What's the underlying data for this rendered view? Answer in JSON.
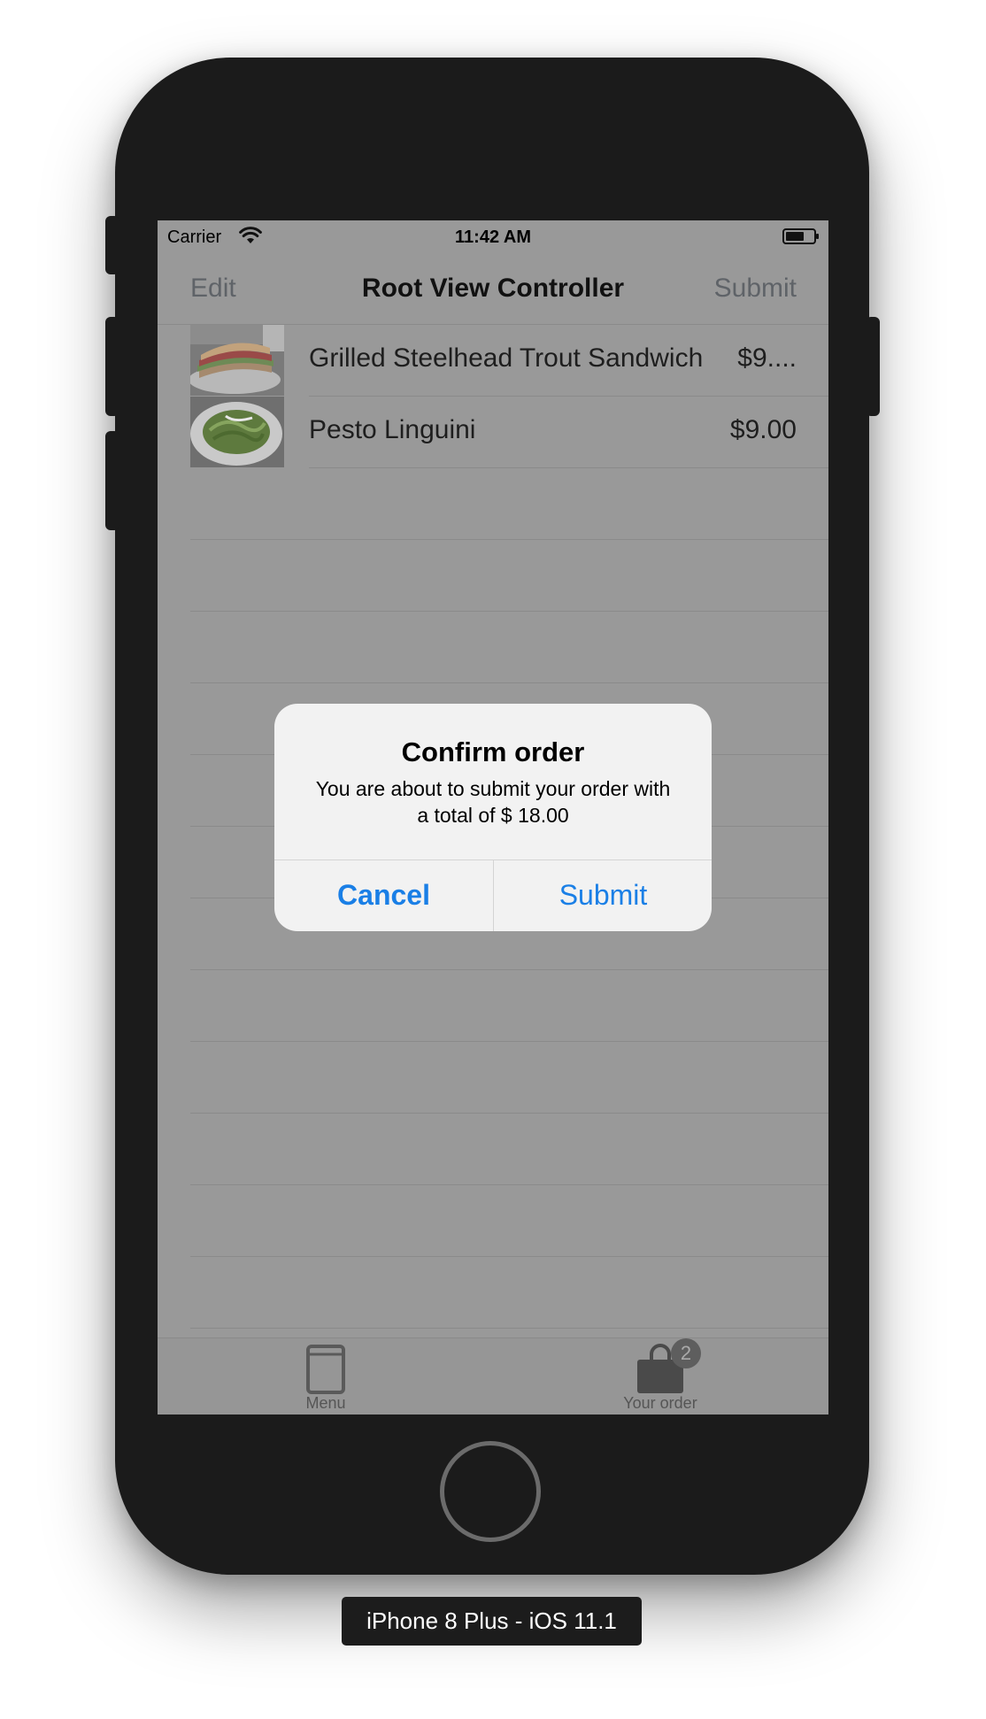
{
  "status_bar": {
    "carrier": "Carrier",
    "time": "11:42 AM",
    "wifi_icon": "wifi-icon",
    "battery_icon": "battery-icon"
  },
  "nav": {
    "left": "Edit",
    "title": "Root View Controller",
    "right": "Submit"
  },
  "order_items": [
    {
      "name": "Grilled Steelhead Trout Sandwich",
      "price": "$9....",
      "image": "sandwich-photo"
    },
    {
      "name": "Pesto Linguini",
      "price": "$9.00",
      "image": "pasta-photo"
    }
  ],
  "tabs": [
    {
      "label": "Menu",
      "icon": "book-icon",
      "selected": false
    },
    {
      "label": "Your order",
      "icon": "bag-icon",
      "badge": "2",
      "selected": true
    }
  ],
  "alert": {
    "title": "Confirm order",
    "message": "You are about to submit your order with a total of $ 18.00",
    "cancel": "Cancel",
    "confirm": "Submit"
  },
  "device_label": "iPhone 8 Plus - iOS 11.1",
  "colors": {
    "accent": "#1a7fe6",
    "dim_overlay": "#999999",
    "device": "#1b1b1b"
  }
}
